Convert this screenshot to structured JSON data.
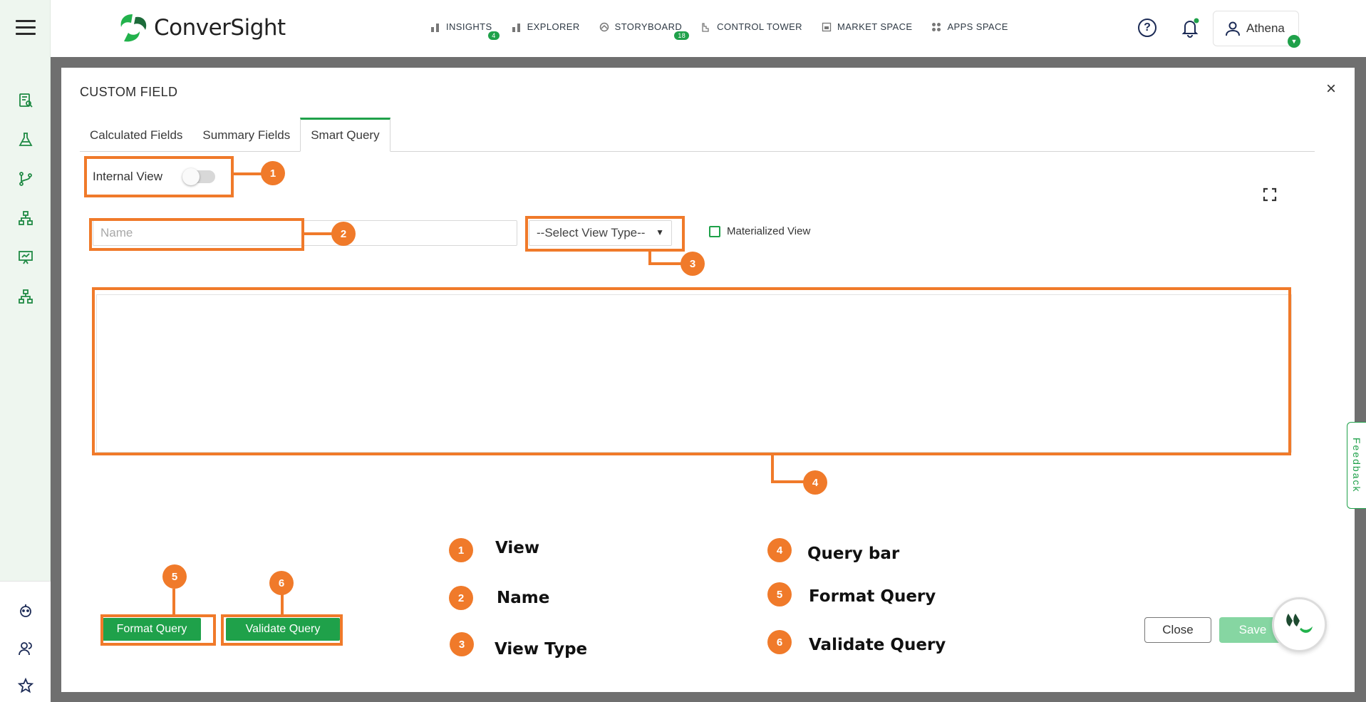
{
  "header": {
    "brand": "ConverSight",
    "nav": [
      {
        "label": "INSIGHTS",
        "badge": "4",
        "icon": "bar-chart-icon"
      },
      {
        "label": "EXPLORER",
        "badge": "",
        "icon": "bar-chart-icon"
      },
      {
        "label": "STORYBOARD",
        "badge": "18",
        "icon": "storyboard-icon"
      },
      {
        "label": "CONTROL TOWER",
        "badge": "",
        "icon": "tower-icon"
      },
      {
        "label": "MARKET SPACE",
        "badge": "",
        "icon": "store-icon"
      },
      {
        "label": "APPS SPACE",
        "badge": "",
        "icon": "grid-icon"
      }
    ],
    "user_name": "Athena"
  },
  "sidebar": {
    "icons": [
      "report-search-icon",
      "flask-icon",
      "git-branch-icon",
      "hierarchy-icon",
      "presentation-icon",
      "hierarchy-icon",
      "robot-icon",
      "users-icon",
      "star-icon"
    ]
  },
  "modal": {
    "title": "CUSTOM FIELD",
    "tabs": [
      "Calculated Fields",
      "Summary Fields",
      "Smart Query"
    ],
    "active_tab": "Smart Query",
    "internal_view_label": "Internal View",
    "internal_view_on": false,
    "name_placeholder": "Name",
    "view_type_placeholder": "--Select View Type--",
    "materialized_view_label": "Materialized View",
    "format_query_label": "Format Query",
    "validate_query_label": "Validate Query",
    "close_label": "Close",
    "save_label": "Save"
  },
  "annotations": {
    "callouts": [
      "1",
      "2",
      "3",
      "4",
      "5",
      "6"
    ],
    "legend": [
      {
        "num": "1",
        "label": "View"
      },
      {
        "num": "2",
        "label": "Name"
      },
      {
        "num": "3",
        "label": "View Type"
      },
      {
        "num": "4",
        "label": "Query bar"
      },
      {
        "num": "5",
        "label": "Format Query"
      },
      {
        "num": "6",
        "label": "Validate Query"
      }
    ],
    "color": "#f07a2a"
  },
  "feedback_label": "Feedback",
  "colors": {
    "accent": "#1fa14a",
    "overlay": "#6f6f6f",
    "annotation": "#f07a2a"
  }
}
